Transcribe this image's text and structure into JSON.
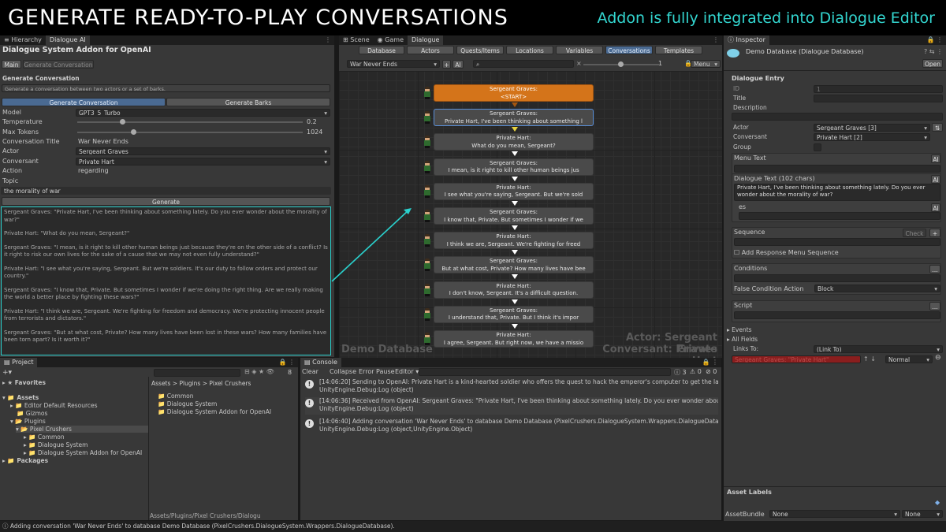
{
  "banner": {
    "title": "GENERATE READY-TO-PLAY CONVERSATIONS",
    "subtitle": "Addon is fully integrated into Dialogue Editor",
    "title_color": "#ffffff",
    "subtitle_color": "#33d6d0"
  },
  "left_panel": {
    "tabs": [
      "Hierarchy",
      "Dialogue AI"
    ],
    "addon_title": "Dialogue System Addon for OpenAI",
    "mode_tabs": [
      "Main",
      "Generate Conversation"
    ],
    "section_heading": "Generate Conversation",
    "description": "Generate a conversation between two actors or a set of barks.",
    "gen_tabs": [
      "Generate Conversation",
      "Generate Barks"
    ],
    "model_label": "Model",
    "model_value": "GPT3_5_Turbo",
    "temperature_label": "Temperature",
    "temperature_value": "0.2",
    "max_tokens_label": "Max Tokens",
    "max_tokens_value": "1024",
    "conv_title_label": "Conversation Title",
    "conv_title_value": "War Never Ends",
    "actor_label": "Actor",
    "actor_value": "Sergeant Graves",
    "conversant_label": "Conversant",
    "conversant_value": "Private Hart",
    "action_label": "Action",
    "action_value": "regarding",
    "topic_label": "Topic",
    "topic_value": "the morality of war",
    "generate_button": "Generate",
    "generated_lines": [
      "Sergeant Graves: \"Private Hart, I've been thinking about something lately. Do you ever wonder about the morality of war?\"",
      "Private Hart: \"What do you mean, Sergeant?\"",
      "Sergeant Graves: \"I mean, is it right to kill other human beings just because they're on the other side of a conflict? Is it right to risk our own lives for the sake of a cause that we may not even fully understand?\"",
      "Private Hart: \"I see what you're saying, Sergeant. But we're soldiers. It's our duty to follow orders and protect our country.\"",
      "Sergeant Graves: \"I know that, Private. But sometimes I wonder if we're doing the right thing. Are we really making the world a better place by fighting these wars?\"",
      "Private Hart: \"I think we are, Sergeant. We're fighting for freedom and democracy. We're protecting innocent people from terrorists and dictators.\"",
      "Sergeant Graves: \"But at what cost, Private? How many lives have been lost in these wars? How many families have been torn apart? Is it worth it?\""
    ],
    "accent_color": "#2ad0cc"
  },
  "center_panel": {
    "tabs": [
      "Scene",
      "Game",
      "Dialogue"
    ],
    "db_tabs": [
      "Database",
      "Actors",
      "Quests/Items",
      "Locations",
      "Variables",
      "Conversations",
      "Templates"
    ],
    "active_db_tab": "Conversations",
    "conversation_select": "War Never Ends",
    "plus_label": "+",
    "ai_label": "AI",
    "zoom_value": "1",
    "menu_label": "Menu",
    "nodes": [
      {
        "speaker": "Sergeant Graves:",
        "text": "<START>",
        "kind": "start"
      },
      {
        "speaker": "Sergeant Graves:",
        "text": "Private Hart, I've been thinking about something l",
        "kind": "selected"
      },
      {
        "speaker": "Private Hart:",
        "text": "What do you mean, Sergeant?",
        "kind": "normal"
      },
      {
        "speaker": "Sergeant Graves:",
        "text": "I mean, is it right to kill other human beings jus",
        "kind": "normal"
      },
      {
        "speaker": "Private Hart:",
        "text": "I see what you're saying, Sergeant. But we're sold",
        "kind": "normal"
      },
      {
        "speaker": "Sergeant Graves:",
        "text": "I know that, Private. But sometimes I wonder if we",
        "kind": "normal"
      },
      {
        "speaker": "Private Hart:",
        "text": "I think we are, Sergeant. We're fighting for freed",
        "kind": "normal"
      },
      {
        "speaker": "Sergeant Graves:",
        "text": "But at what cost, Private? How many lives have bee",
        "kind": "normal"
      },
      {
        "speaker": "Private Hart:",
        "text": "I don't know, Sergeant. It's a difficult question.",
        "kind": "normal"
      },
      {
        "speaker": "Sergeant Graves:",
        "text": "I understand that, Private. But I think it's impor",
        "kind": "normal"
      },
      {
        "speaker": "Private Hart:",
        "text": "I agree, Sergeant. But right now, we have a missio",
        "kind": "normal"
      }
    ],
    "watermark_left": "Demo Database",
    "watermark_actor": "Actor: Sergeant Graves",
    "watermark_conversant": "Conversant: Private Hart",
    "start_color": "#d4741a"
  },
  "project": {
    "tab": "Project",
    "favorites": "Favorites",
    "assets": "Assets",
    "tree": [
      "Editor Default Resources",
      "Gizmos",
      "Plugins",
      "Pixel Crushers",
      "Common",
      "Dialogue System",
      "Dialogue System Addon for OpenAI",
      "Packages"
    ],
    "breadcrumb": "Assets > Plugins > Pixel Crushers",
    "folders": [
      "Common",
      "Dialogue System",
      "Dialogue System Addon for OpenAI"
    ],
    "path_footer": "Assets/Plugins/Pixel Crushers/Dialogu",
    "count_badge": "8"
  },
  "console": {
    "tab": "Console",
    "buttons": [
      "Clear",
      "Collapse",
      "Error Pause",
      "Editor"
    ],
    "counts": [
      "3",
      "0",
      "0"
    ],
    "logs": [
      {
        "line1": "[14:06:20] Sending to OpenAI: Private Hart is a kind-hearted soldier who offers the quest to hack the emperor's computer to get the launch codes. S",
        "line2": "UnityEngine.Debug:Log (object)"
      },
      {
        "line1": "[14:06:36] Received from OpenAI: Sergeant Graves: \"Private Hart, I've been thinking about something lately. Do you ever wonder about the moralit",
        "line2": "UnityEngine.Debug:Log (object)"
      },
      {
        "line1": "[14:06:40] Adding conversation 'War Never Ends' to database Demo Database (PixelCrushers.DialogueSystem.Wrappers.DialogueDatabase).",
        "line2": "UnityEngine.Debug:Log (object,UnityEngine.Object)"
      }
    ]
  },
  "inspector": {
    "tab": "Inspector",
    "title": "Demo Database (Dialogue Database)",
    "open_button": "Open",
    "section": "Dialogue Entry",
    "id_label": "ID",
    "id_value": "1",
    "title_label": "Title",
    "description_label": "Description",
    "actor_label": "Actor",
    "actor_value": "Sergeant Graves [3]",
    "conversant_label": "Conversant",
    "conversant_value": "Private Hart [2]",
    "group_label": "Group",
    "menu_text_label": "Menu Text",
    "ai_label": "AI",
    "dialogue_text_label": "Dialogue Text (102 chars)",
    "dialogue_text_value": "Private Hart, I've been thinking about something lately. Do you ever wonder about the morality of war?",
    "es_label": "es",
    "sequence_label": "Sequence",
    "check_label": "Check",
    "add_response_label": "Add Response Menu Sequence",
    "conditions_label": "Conditions",
    "false_action_label": "False Condition Action",
    "false_action_value": "Block",
    "script_label": "Script",
    "events_label": "Events",
    "all_fields_label": "All Fields",
    "links_to_label": "Links To:",
    "links_to_value": "(Link To)",
    "link_entry_value": "Sergeant Graves: \"Private Hart\"",
    "normal_value": "Normal",
    "asset_labels": "Asset Labels",
    "asset_bundle_label": "AssetBundle",
    "asset_bundle_value": "None",
    "asset_variant_value": "None"
  },
  "status_bar": "Adding conversation 'War Never Ends' to database Demo Database (PixelCrushers.DialogueSystem.Wrappers.DialogueDatabase)."
}
